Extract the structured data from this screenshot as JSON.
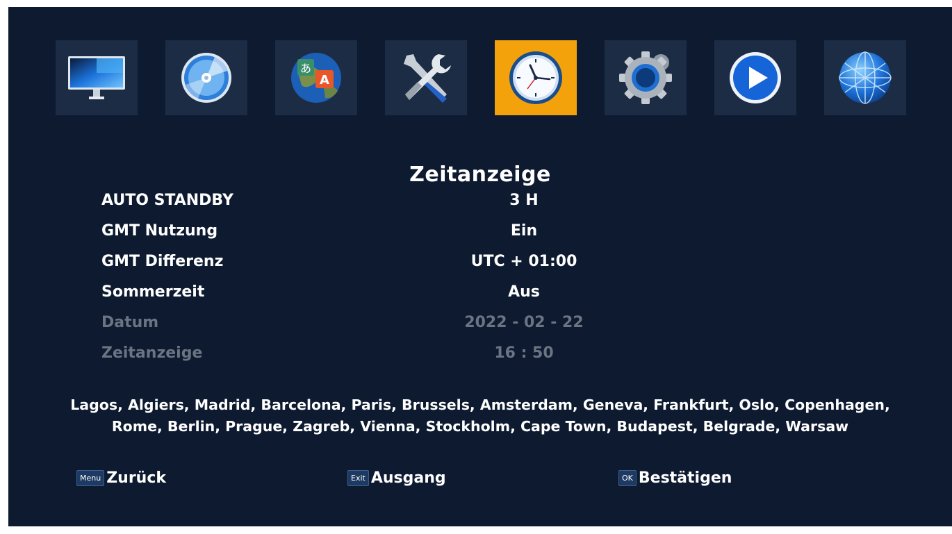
{
  "menu": {
    "tabs": [
      {
        "icon": "monitor-icon",
        "active": false
      },
      {
        "icon": "disc-icon",
        "active": false
      },
      {
        "icon": "language-globe-icon",
        "active": false
      },
      {
        "icon": "tools-icon",
        "active": false
      },
      {
        "icon": "clock-icon",
        "active": true
      },
      {
        "icon": "gear-icon",
        "active": false
      },
      {
        "icon": "play-icon",
        "active": false
      },
      {
        "icon": "network-globe-icon",
        "active": false
      }
    ],
    "active_color": "#f4a20c"
  },
  "page": {
    "title": "Zeitanzeige",
    "settings": [
      {
        "label": "AUTO STANDBY",
        "value": "3 H"
      },
      {
        "label": "GMT Nutzung",
        "value": "Ein"
      },
      {
        "label": "GMT Differenz",
        "value": "UTC + 01:00"
      },
      {
        "label": "Sommerzeit",
        "value": "Aus"
      },
      {
        "label": "Datum",
        "value": "2022 - 02 - 22"
      },
      {
        "label": "Zeitanzeige",
        "value": "16 : 50"
      }
    ],
    "cities_line1": "Lagos, Algiers, Madrid, Barcelona, Paris, Brussels, Amsterdam, Geneva, Frankfurt, Oslo, Copenhagen,",
    "cities_line2": "Rome, Berlin, Prague, Zagreb, Vienna, Stockholm, Cape Town, Budapest, Belgrade, Warsaw"
  },
  "footer": {
    "menu_key": "Menu",
    "menu_label": "Zurück",
    "exit_key": "Exit",
    "exit_label": "Ausgang",
    "ok_key": "OK",
    "ok_label": "Bestätigen"
  }
}
